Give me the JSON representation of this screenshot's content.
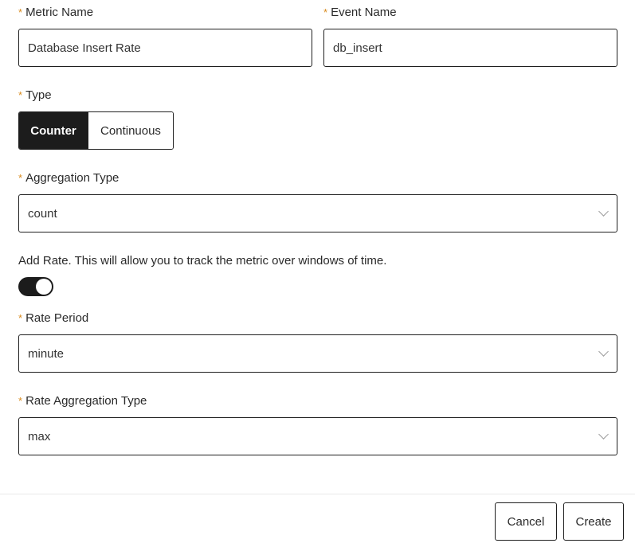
{
  "form": {
    "metric_name": {
      "label": "Metric Name",
      "value": "Database Insert Rate"
    },
    "event_name": {
      "label": "Event Name",
      "value": "db_insert"
    },
    "type": {
      "label": "Type",
      "options": [
        "Counter",
        "Continuous"
      ],
      "selected": "Counter"
    },
    "aggregation_type": {
      "label": "Aggregation Type",
      "value": "count"
    },
    "add_rate": {
      "label": "Add Rate. This will allow you to track the metric over windows of time.",
      "enabled": true
    },
    "rate_period": {
      "label": "Rate Period",
      "value": "minute"
    },
    "rate_aggregation_type": {
      "label": "Rate Aggregation Type",
      "value": "max"
    }
  },
  "required_marker": "*",
  "footer": {
    "cancel_label": "Cancel",
    "create_label": "Create"
  },
  "colors": {
    "required": "#d98b1e",
    "active_segment": "#1c1c1c",
    "toggle_on": "#1c1c1c"
  },
  "icons": {
    "select_arrow": "chevron-down-icon"
  }
}
